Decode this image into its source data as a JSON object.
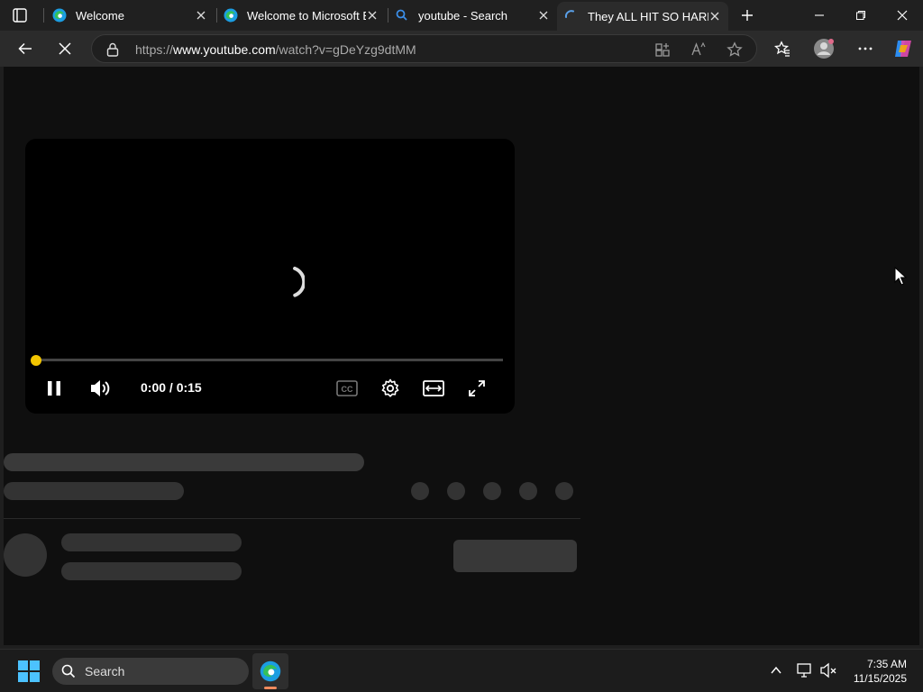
{
  "tabs": [
    {
      "title": "Welcome",
      "favicon": "edge-icon",
      "active": false
    },
    {
      "title": "Welcome to Microsoft E",
      "favicon": "edge-icon",
      "active": false
    },
    {
      "title": "youtube - Search",
      "favicon": "search-icon",
      "active": false
    },
    {
      "title": "They ALL HIT SO HARD!",
      "favicon": "loading-spinner-icon",
      "active": true
    }
  ],
  "address": {
    "prefix": "https://",
    "host": "www.youtube.com",
    "path": "/watch?v=gDeYzg9dtMM"
  },
  "player": {
    "time": "0:00 / 0:15",
    "progress": 0.0,
    "accent": "#f2c500"
  },
  "taskbar": {
    "search_label": "Search",
    "time": "7:35 AM",
    "date": "11/15/2025"
  }
}
